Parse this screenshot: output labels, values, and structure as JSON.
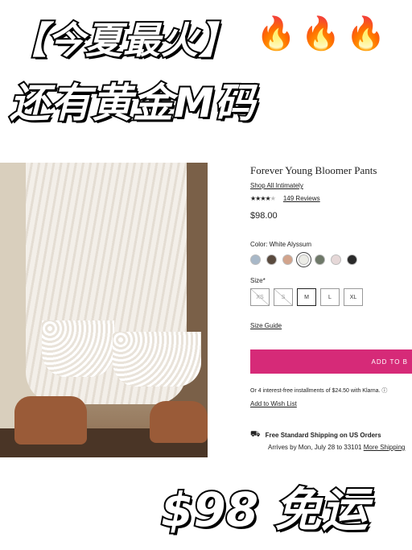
{
  "banner": {
    "line1": "【今夏最火】",
    "line2": "还有黄金M码",
    "fire_icon": "🔥",
    "bottom_text": "$98 免运"
  },
  "product": {
    "title": "Forever Young Bloomer Pants",
    "shop_all": "Shop All Intimately",
    "stars": "★★★★",
    "star_empty": "★",
    "reviews": "149 Reviews",
    "price": "$98.00",
    "color_label": "Color: White Alyssum",
    "swatches": [
      "#a8b8c8",
      "#5a4a3e",
      "#d2a48c",
      "#ecece6",
      "#6e7868",
      "#e6d8d8",
      "#2a2a2a"
    ],
    "selected_swatch_index": 3,
    "size_label": "Size*",
    "sizes": [
      {
        "label": "XS",
        "state": "disabled"
      },
      {
        "label": "S",
        "state": "disabled"
      },
      {
        "label": "M",
        "state": "selected"
      },
      {
        "label": "L",
        "state": "available"
      },
      {
        "label": "XL",
        "state": "available"
      }
    ],
    "size_guide": "Size Guide",
    "add_button": "ADD TO B",
    "installments": "Or 4 interest-free installments of $24.50 with Klarna.",
    "info_icon": "ⓘ",
    "wishlist": "Add to Wish List",
    "shipping_title": "Free Standard Shipping on US Orders",
    "arrives_text": "Arrives by Mon, July 28 to 33101",
    "more_shipping": "More Shipping",
    "accent_color": "#d62a78"
  }
}
